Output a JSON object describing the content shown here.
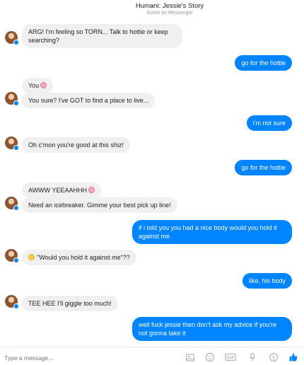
{
  "header": {
    "title": "Humani: Jessie's Story",
    "status": "Active on Messenger"
  },
  "messages": [
    {
      "from": "in",
      "text": "ARG! I'm feeling so TORN... Talk to hottie or keep searching?"
    },
    {
      "from": "out",
      "text": "go for the hottie"
    },
    {
      "from": "in",
      "text": "You"
    },
    {
      "from": "in",
      "text": "You sure? I've GOT to find a place to live..."
    },
    {
      "from": "out",
      "text": "i'm not sure"
    },
    {
      "from": "in",
      "text": "Oh c'mon you're good at this shiz!"
    },
    {
      "from": "out",
      "text": "go for the hottie"
    },
    {
      "from": "in",
      "text": "AWWW YEEAAHHH"
    },
    {
      "from": "in",
      "text": "Need an icebreaker. Gimme your best pick up line!"
    },
    {
      "from": "out",
      "text": "if i told you you had a nice body would you hold it against me"
    },
    {
      "from": "in",
      "text": "\"Would you hold it against me\"??"
    },
    {
      "from": "out",
      "text": "like, his body"
    },
    {
      "from": "in",
      "text": "TEE HEE I'll giggle too much!"
    },
    {
      "from": "out",
      "text": "well fuck jessie then don't ask my advice if you're not gonna take it"
    }
  ],
  "emojis": {
    "pig": "pig-face",
    "sweat": "sweat-smile-face"
  },
  "composer": {
    "placeholder": "Type a message...",
    "tools": [
      "photo-icon",
      "emoji-icon",
      "gif-icon",
      "microphone-icon",
      "dollar-icon",
      "like-icon"
    ]
  },
  "colors": {
    "accent": "#0084ff",
    "incoming_bubble": "#f1f0f0"
  }
}
